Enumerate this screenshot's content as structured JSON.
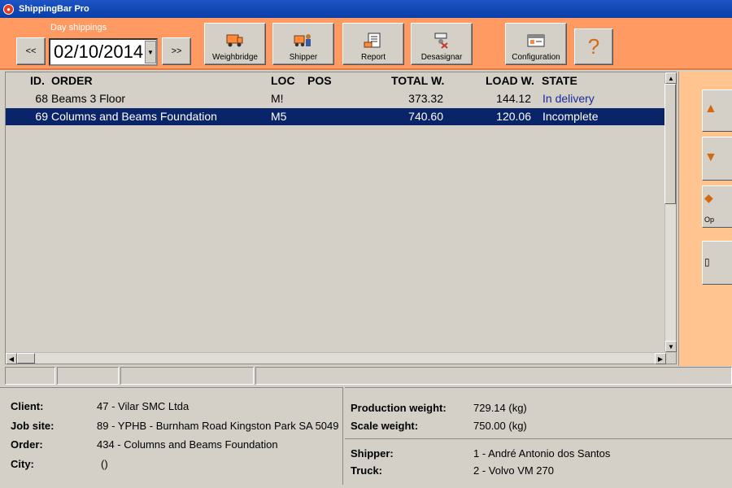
{
  "window": {
    "title": "ShippingBar Pro"
  },
  "toolbar": {
    "day_label": "Day shippings",
    "prev_label": "<<",
    "next_label": ">>",
    "date_value": "02/10/2014",
    "buttons": {
      "weighbridge": "Weighbridge",
      "shipper": "Shipper",
      "report": "Report",
      "desasignar": "Desasignar",
      "configuration": "Configuration",
      "help": "?"
    }
  },
  "list": {
    "headers": {
      "id": "ID.",
      "order": "ORDER",
      "loc": "LOC",
      "pos": "POS",
      "total_w": "TOTAL W.",
      "load_w": "LOAD W.",
      "state": "STATE"
    },
    "rows": [
      {
        "id": "68",
        "order": "Beams 3 Floor",
        "loc": "M!",
        "pos": "",
        "total_w": "373.32",
        "load_w": "144.12",
        "state": "In delivery"
      },
      {
        "id": "69",
        "order": "Columns and Beams Foundation",
        "loc": "M5",
        "pos": "",
        "total_w": "740.60",
        "load_w": "120.06",
        "state": "Incomplete"
      }
    ]
  },
  "right_panel": {
    "buttons": {
      "op_label": "Op"
    }
  },
  "details": {
    "client_label": "Client:",
    "client_value": "47 - Vilar SMC Ltda",
    "jobsite_label": "Job site:",
    "jobsite_value": "89 - YPHB -  Burnham Road Kingston Park SA 5049",
    "order_label": "Order:",
    "order_value": "434 - Columns and Beams Foundation",
    "city_label": "City:",
    "city_value": "()",
    "prod_weight_label": "Production weight:",
    "prod_weight_value": "729.14 (kg)",
    "scale_weight_label": "Scale weight:",
    "scale_weight_value": "750.00 (kg)",
    "shipper_label": "Shipper:",
    "shipper_value": "1 - André Antonio dos Santos",
    "truck_label": "Truck:",
    "truck_value": "2 - Volvo VM 270"
  },
  "colors": {
    "toolbar_bg": "#ff9b62",
    "selection": "#0a246a",
    "state_blue": "#1a2a9a"
  }
}
